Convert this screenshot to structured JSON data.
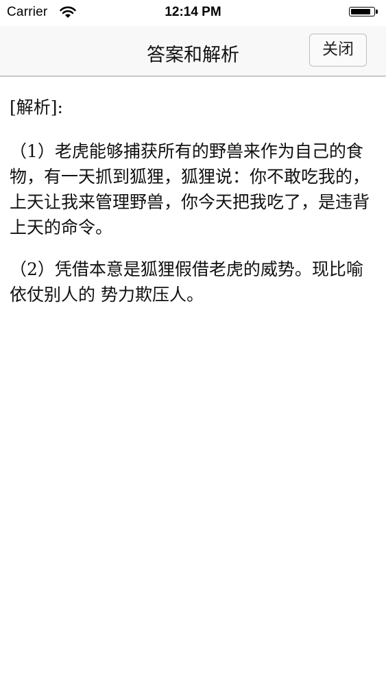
{
  "status_bar": {
    "carrier": "Carrier",
    "time": "12:14 PM",
    "battery_level": 0.9,
    "signal_icon": "wifi-icon",
    "battery_icon": "battery-icon"
  },
  "nav": {
    "title": "答案和解析",
    "close_label": "关闭"
  },
  "content": {
    "heading": "[解析]:",
    "paragraphs": [
      "（1）老虎能够捕获所有的野兽来作为自己的食物，有一天抓到狐狸，狐狸说：你不敢吃我的，上天让我来管理野兽，你今天把我吃了，是违背上天的命令。",
      "（2）凭借本意是狐狸假借老虎的威势。现比喻依仗别人的 势力欺压人。"
    ]
  }
}
